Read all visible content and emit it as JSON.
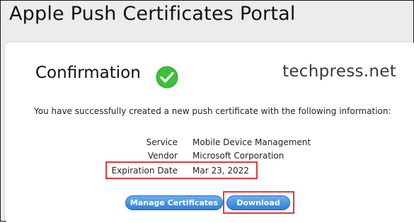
{
  "page_title": "Apple Push Certificates Portal",
  "confirmation": {
    "heading": "Confirmation",
    "watermark": "techpress.net",
    "message": "You have successfully created a new push certificate with the following information:"
  },
  "details": [
    {
      "label": "Service",
      "value": "Mobile Device Management"
    },
    {
      "label": "Vendor",
      "value": "Microsoft Corporation"
    },
    {
      "label": "Expiration Date",
      "value": "Mar 23, 2022"
    }
  ],
  "buttons": {
    "manage": "Manage Certificates",
    "download": "Download"
  },
  "colors": {
    "success": "#3cc13b",
    "highlight": "#e53935",
    "button": "#2f7fd6"
  }
}
